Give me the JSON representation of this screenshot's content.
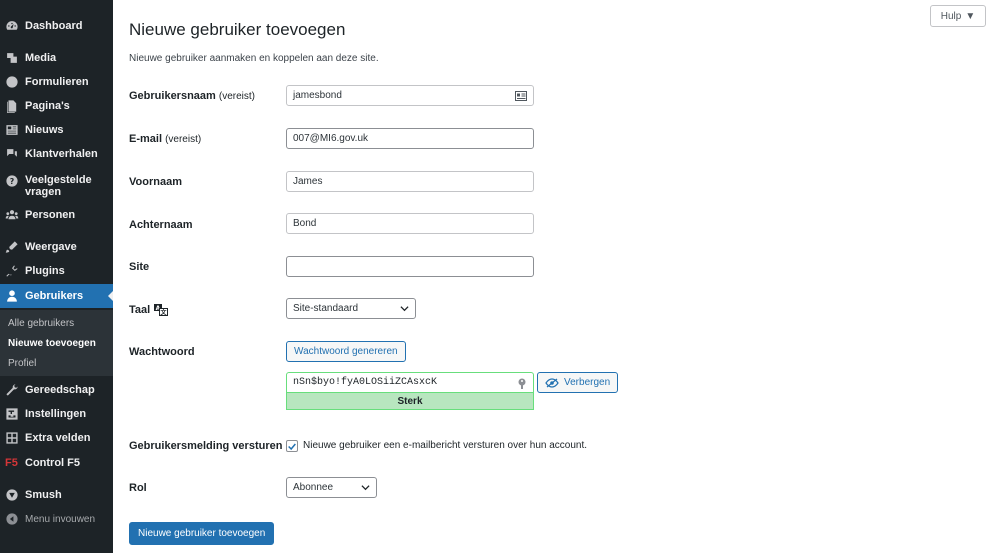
{
  "sidebar": {
    "items": {
      "dashboard": "Dashboard",
      "media": "Media",
      "formulieren": "Formulieren",
      "paginas": "Pagina's",
      "nieuws": "Nieuws",
      "klantverhalen": "Klantverhalen",
      "veelgestelde": "Veelgestelde vragen",
      "personen": "Personen",
      "weergave": "Weergave",
      "plugins": "Plugins",
      "gebruikers": "Gebruikers",
      "gereedschap": "Gereedschap",
      "instellingen": "Instellingen",
      "extra_velden": "Extra velden",
      "control_f5": "Control F5",
      "f5_logo": "F5",
      "smush": "Smush",
      "menu_invouwen": "Menu invouwen"
    },
    "submenu": {
      "alle_gebruikers": "Alle gebruikers",
      "nieuwe_toevoegen": "Nieuwe toevoegen",
      "profiel": "Profiel"
    }
  },
  "header": {
    "help_label": "Hulp",
    "title": "Nieuwe gebruiker toevoegen",
    "description": "Nieuwe gebruiker aanmaken en koppelen aan deze site."
  },
  "form": {
    "username": {
      "label": "Gebruikersnaam",
      "required": "(vereist)",
      "value": "jamesbond"
    },
    "email": {
      "label": "E-mail",
      "required": "(vereist)",
      "value": "007@MI6.gov.uk"
    },
    "firstname": {
      "label": "Voornaam",
      "value": "James"
    },
    "lastname": {
      "label": "Achternaam",
      "value": "Bond"
    },
    "site": {
      "label": "Site",
      "value": ""
    },
    "language": {
      "label": "Taal",
      "selected": "Site-standaard"
    },
    "password": {
      "label": "Wachtwoord",
      "generate_label": "Wachtwoord genereren",
      "value": "nSn$byo!fyA0LOSiiZCAsxcK",
      "hide_label": "Verbergen",
      "strength": "Sterk"
    },
    "notification": {
      "label": "Gebruikersmelding versturen",
      "checked": true,
      "text": "Nieuwe gebruiker een e-mailbericht versturen over hun account."
    },
    "role": {
      "label": "Rol",
      "selected": "Abonnee"
    },
    "submit_label": "Nieuwe gebruiker toevoegen"
  },
  "colors": {
    "accent": "#2271b1",
    "sidebar_bg": "#1d2327",
    "strength_bg": "#b8e6bf"
  }
}
